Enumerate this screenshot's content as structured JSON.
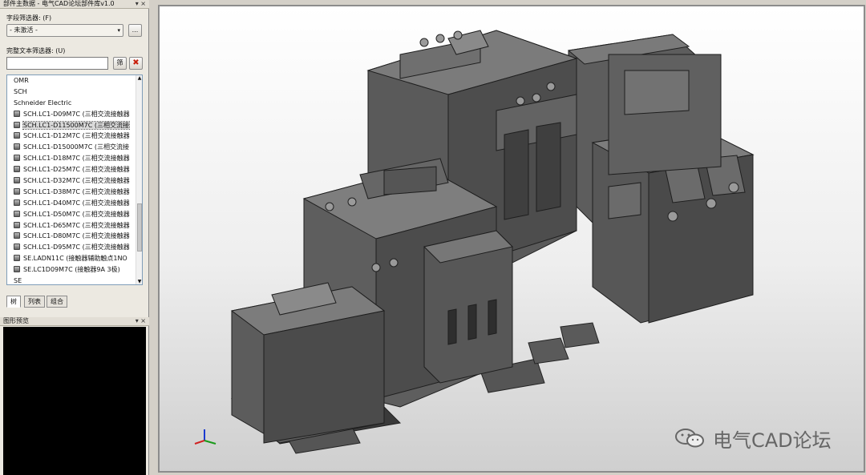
{
  "left_panel": {
    "title": "部件主数据 - 电气CAD论坛部件库v1.0",
    "pin": "▾ ×",
    "field_filter_label": "字段筛选器: (F)",
    "field_filter_value": "- 未激活 -",
    "field_filter_more": "...",
    "fulltext_filter_label": "完整文本筛选器: (U)",
    "fulltext_value": "",
    "fulltext_apply": "筛",
    "fulltext_clear": "✖"
  },
  "tree": {
    "items": [
      {
        "label": "OMR",
        "type": "group"
      },
      {
        "label": "SCH",
        "type": "group"
      },
      {
        "label": "Schneider Electric",
        "type": "group"
      },
      {
        "label": "SCH.LC1-D09M7C (三相交流接触器",
        "type": "part"
      },
      {
        "label": "SCH.LC1-D11500M7C (三相交流接",
        "type": "part",
        "selected": true
      },
      {
        "label": "SCH.LC1-D12M7C (三相交流接触器",
        "type": "part"
      },
      {
        "label": "SCH.LC1-D15000M7C (三相交流接",
        "type": "part"
      },
      {
        "label": "SCH.LC1-D18M7C (三相交流接触器",
        "type": "part"
      },
      {
        "label": "SCH.LC1-D25M7C (三相交流接触器",
        "type": "part"
      },
      {
        "label": "SCH.LC1-D32M7C (三相交流接触器",
        "type": "part"
      },
      {
        "label": "SCH.LC1-D38M7C (三相交流接触器",
        "type": "part"
      },
      {
        "label": "SCH.LC1-D40M7C (三相交流接触器",
        "type": "part"
      },
      {
        "label": "SCH.LC1-D50M7C (三相交流接触器",
        "type": "part"
      },
      {
        "label": "SCH.LC1-D65M7C (三相交流接触器",
        "type": "part"
      },
      {
        "label": "SCH.LC1-D80M7C (三相交流接触器",
        "type": "part"
      },
      {
        "label": "SCH.LC1-D95M7C (三相交流接触器",
        "type": "part"
      },
      {
        "label": "SE.LADN11C (接触器辅助触点1NO",
        "type": "part"
      },
      {
        "label": "SE.LC1D09M7C (接触器9A 3极)",
        "type": "part"
      },
      {
        "label": "SE",
        "type": "group"
      }
    ]
  },
  "tabs": [
    {
      "label": "树",
      "active": true
    },
    {
      "label": "列表",
      "active": false
    },
    {
      "label": "组合",
      "active": false
    }
  ],
  "preview_panel": {
    "title": "图形预览",
    "pin": "▾ ×"
  },
  "viewport": {
    "watermark": "电气CAD论坛",
    "axis_colors": {
      "x": "#d02020",
      "y": "#1a9a1a",
      "z": "#1a3ad0"
    }
  },
  "icons": {
    "part": "part-icon",
    "combo_arrow": "▾",
    "scroll_up": "▲",
    "scroll_down": "▼"
  }
}
